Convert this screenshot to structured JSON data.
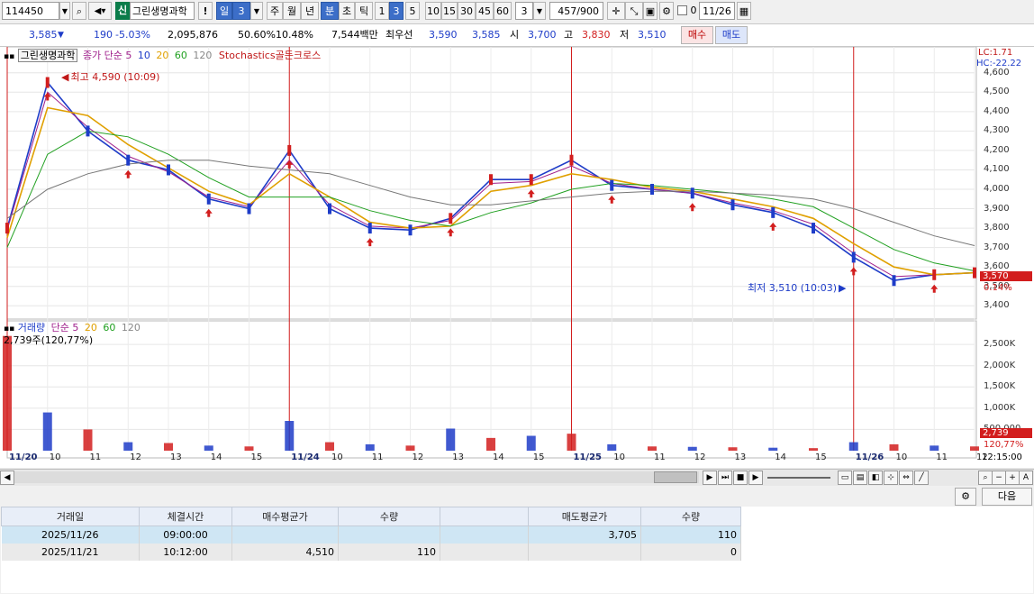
{
  "toolbar": {
    "stock_code": "114450",
    "new_badge": "신",
    "stock_name": "그린생명과학",
    "alert_icon": "!",
    "period_day": "일",
    "period_num": "3",
    "period_week": "주",
    "period_month": "월",
    "period_year": "년",
    "period_minute": "분",
    "period_second": "초",
    "period_tick": "틱",
    "interval_options": [
      "1",
      "3",
      "5",
      "10",
      "15",
      "30",
      "45",
      "60"
    ],
    "interval_value": "3",
    "count_display": "457",
    "count_total": "/900",
    "checkbox_label": "0",
    "date_value": "11/26"
  },
  "quote": {
    "price": "3,585",
    "change": "190",
    "change_pct": "-5.03%",
    "volume": "2,095,876",
    "vol_ratio": "50.60%",
    "turnover": "10.48%",
    "amount": "7,544백만",
    "best_label": "최우선",
    "best_ask": "3,590",
    "best_bid": "3,585",
    "open_label": "시",
    "open": "3,700",
    "high_label": "고",
    "high": "3,830",
    "low_label": "저",
    "low": "3,510",
    "buy_label": "매수",
    "sell_label": "매도"
  },
  "price_panel": {
    "name": "그린생명과학",
    "ma_label": "종가 단순",
    "ma_periods": [
      "5",
      "10",
      "20",
      "60",
      "120"
    ],
    "ma_colors": [
      "#d01818",
      "#1e3cc8",
      "#e0a000",
      "#20a020",
      "#888888"
    ],
    "signal_label": "Stochastics골든크로스",
    "lc_label": "LC:1.71",
    "hc_label": "HC:-22.22",
    "high_marker": "최고 4,590 (10:09)",
    "low_marker": "최저 3,510 (10:03)",
    "current_tag": "3,570",
    "current_pct": "0.14%",
    "y_ticks": [
      "4,600",
      "4,500",
      "4,400",
      "4,300",
      "4,200",
      "4,100",
      "4,000",
      "3,900",
      "3,800",
      "3,700",
      "3,600",
      "3,500",
      "3,400"
    ]
  },
  "volume_panel": {
    "title": "거래량",
    "ma_label": "단순",
    "ma_periods": [
      "5",
      "20",
      "60",
      "120"
    ],
    "value_label": "2,739주(120,77%)",
    "y_ticks": [
      "2,500K",
      "2,000K",
      "1,500K",
      "1,000K",
      "500,000"
    ],
    "current_tag": "2,739",
    "current_pct": "120,77%"
  },
  "x_axis": {
    "labels": [
      {
        "t": "11/20",
        "day": true
      },
      {
        "t": "10"
      },
      {
        "t": "11"
      },
      {
        "t": "12"
      },
      {
        "t": "13"
      },
      {
        "t": "14"
      },
      {
        "t": "15"
      },
      {
        "t": "11/24",
        "day": true
      },
      {
        "t": "10"
      },
      {
        "t": "11"
      },
      {
        "t": "12"
      },
      {
        "t": "13"
      },
      {
        "t": "14"
      },
      {
        "t": "15"
      },
      {
        "t": "11/25",
        "day": true
      },
      {
        "t": "10"
      },
      {
        "t": "11"
      },
      {
        "t": "12"
      },
      {
        "t": "13"
      },
      {
        "t": "14"
      },
      {
        "t": "15"
      },
      {
        "t": "11/26",
        "day": true
      },
      {
        "t": "10"
      },
      {
        "t": "11"
      },
      {
        "t": "12"
      }
    ],
    "time_label": "12:15:00"
  },
  "bottom": {
    "next_label": "다음",
    "headers": [
      "거래일",
      "체결시간",
      "매수평균가",
      "수량",
      "",
      "매도평균가",
      "수량"
    ],
    "rows": [
      [
        "2025/11/26",
        "09:00:00",
        "",
        "",
        "",
        "3,705",
        "110"
      ],
      [
        "2025/11/21",
        "10:12:00",
        "4,510",
        "110",
        "",
        "",
        "0"
      ]
    ]
  },
  "chart_data": {
    "type": "line",
    "title": "그린생명과학",
    "x": [
      "11/20",
      "11/20 10",
      "11/20 11",
      "11/20 12",
      "11/20 13",
      "11/20 14",
      "11/20 15",
      "11/24",
      "11/24 10",
      "11/24 11",
      "11/24 12",
      "11/24 13",
      "11/24 14",
      "11/24 15",
      "11/25",
      "11/25 10",
      "11/25 11",
      "11/25 12",
      "11/25 13",
      "11/25 14",
      "11/25 15",
      "11/26",
      "11/26 10",
      "11/26 11",
      "11/26 12"
    ],
    "series": [
      {
        "name": "price",
        "values": [
          3800,
          4550,
          4300,
          4150,
          4100,
          3950,
          3900,
          4200,
          3900,
          3800,
          3790,
          3850,
          4050,
          4050,
          4150,
          4020,
          4000,
          3980,
          3920,
          3880,
          3800,
          3650,
          3530,
          3560,
          3570
        ]
      },
      {
        "name": "5",
        "values": [
          3790,
          4500,
          4320,
          4170,
          4090,
          3960,
          3910,
          4150,
          3920,
          3810,
          3800,
          3840,
          4030,
          4040,
          4120,
          4030,
          4000,
          3980,
          3930,
          3890,
          3820,
          3670,
          3550,
          3560,
          3570
        ]
      },
      {
        "name": "20",
        "values": [
          3750,
          4420,
          4380,
          4230,
          4110,
          3990,
          3920,
          4080,
          3960,
          3830,
          3800,
          3810,
          3990,
          4020,
          4080,
          4050,
          4010,
          3990,
          3950,
          3910,
          3850,
          3720,
          3600,
          3560,
          3570
        ]
      },
      {
        "name": "60",
        "values": [
          3700,
          4180,
          4300,
          4270,
          4180,
          4060,
          3960,
          3960,
          3960,
          3890,
          3840,
          3810,
          3880,
          3930,
          4000,
          4030,
          4020,
          4000,
          3980,
          3950,
          3910,
          3800,
          3690,
          3620,
          3580
        ]
      },
      {
        "name": "120",
        "values": [
          3850,
          4000,
          4080,
          4130,
          4150,
          4150,
          4120,
          4100,
          4080,
          4020,
          3960,
          3920,
          3920,
          3940,
          3960,
          3980,
          3990,
          3990,
          3980,
          3970,
          3950,
          3900,
          3830,
          3760,
          3710
        ]
      }
    ],
    "volume": [
      2700,
      900,
      500,
      200,
      180,
      120,
      100,
      700,
      200,
      150,
      120,
      520,
      300,
      350,
      400,
      150,
      100,
      90,
      80,
      70,
      60,
      200,
      150,
      120,
      100
    ],
    "ylim": [
      3350,
      4650
    ],
    "volume_ylim": [
      0,
      2800
    ]
  }
}
